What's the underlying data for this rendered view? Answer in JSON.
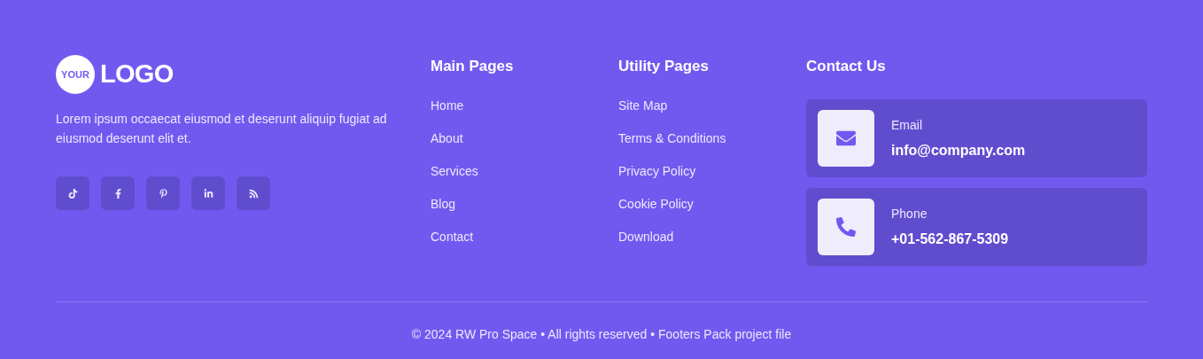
{
  "logo": {
    "badge": "YOUR",
    "text": "LOGO"
  },
  "description": "Lorem ipsum occaecat eiusmod et deserunt aliquip fugiat ad eiusmod deserunt elit et.",
  "columns": [
    {
      "title": "Main Pages",
      "links": [
        "Home",
        "About",
        "Services",
        "Blog",
        "Contact"
      ]
    },
    {
      "title": "Utility Pages",
      "links": [
        "Site Map",
        "Terms & Conditions",
        "Privacy Policy",
        "Cookie Policy",
        "Download"
      ]
    }
  ],
  "contact": {
    "title": "Contact Us",
    "items": [
      {
        "kind": "email",
        "label": "Email",
        "value": "info@company.com"
      },
      {
        "kind": "phone",
        "label": "Phone",
        "value": "+01-562-867-5309"
      }
    ]
  },
  "copyright": "© 2024 RW Pro Space • All rights reserved • Footers Pack project file"
}
